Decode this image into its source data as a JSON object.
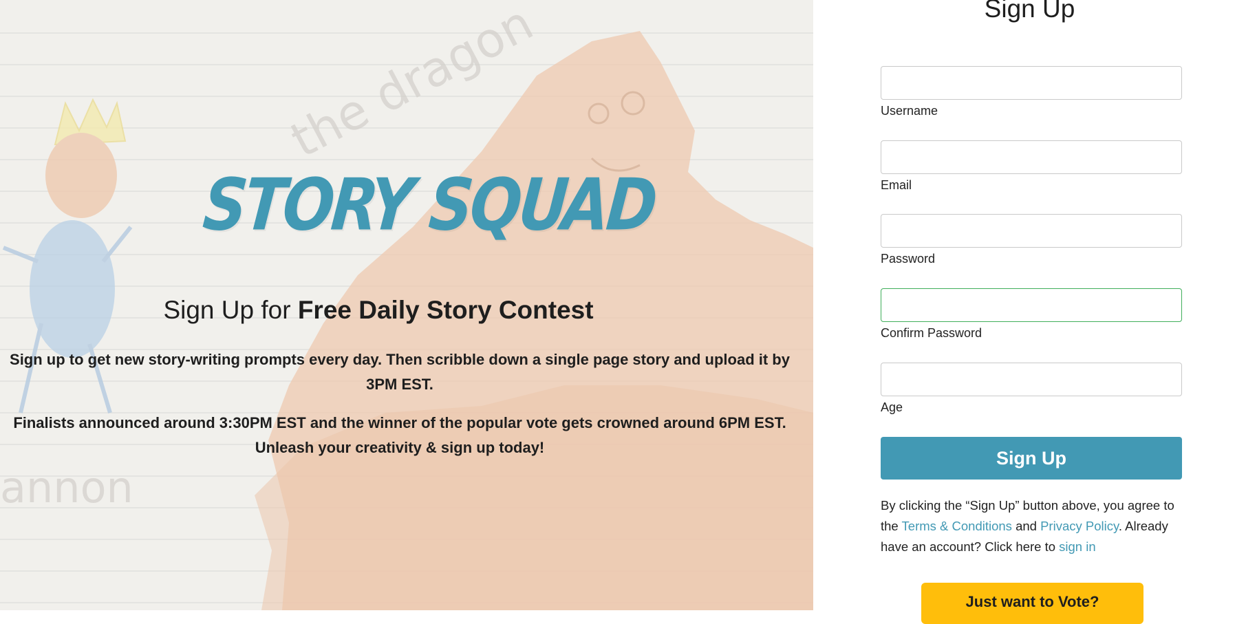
{
  "hero": {
    "logo_text": "STORY SQUAD",
    "drawing_caption_1": "the dragon",
    "drawing_caption_2": "annon",
    "headline_prefix": "Sign Up for ",
    "headline_bold": "Free Daily Story Contest",
    "paragraph_1": "Sign up to get new story-writing prompts every day. Then scribble down a single page story and upload it by 3PM EST.",
    "paragraph_2": "Finalists announced around 3:30PM EST and the winner of the popular vote gets crowned around 6PM EST. Unleash your creativity & sign up today!"
  },
  "form": {
    "title": "Sign Up",
    "fields": {
      "username": {
        "label": "Username",
        "value": ""
      },
      "email": {
        "label": "Email",
        "value": ""
      },
      "password": {
        "label": "Password",
        "value": ""
      },
      "confirm_password": {
        "label": "Confirm Password",
        "value": ""
      },
      "age": {
        "label": "Age",
        "value": ""
      }
    },
    "submit_label": "Sign Up",
    "terms": {
      "before": "By clicking the “Sign Up” button above, you agree to the ",
      "terms_link": "Terms & Conditions",
      "and": " and ",
      "privacy_link": "Privacy Policy",
      "middle": ". Already have an account? Click here to ",
      "signin_link": "sign in"
    },
    "vote_label": "Just want to Vote?"
  },
  "colors": {
    "brand": "#4299b4",
    "vote_button": "#ffbe0b",
    "focus_border": "#3fae5a",
    "drawing_orange": "#e8a97c"
  }
}
